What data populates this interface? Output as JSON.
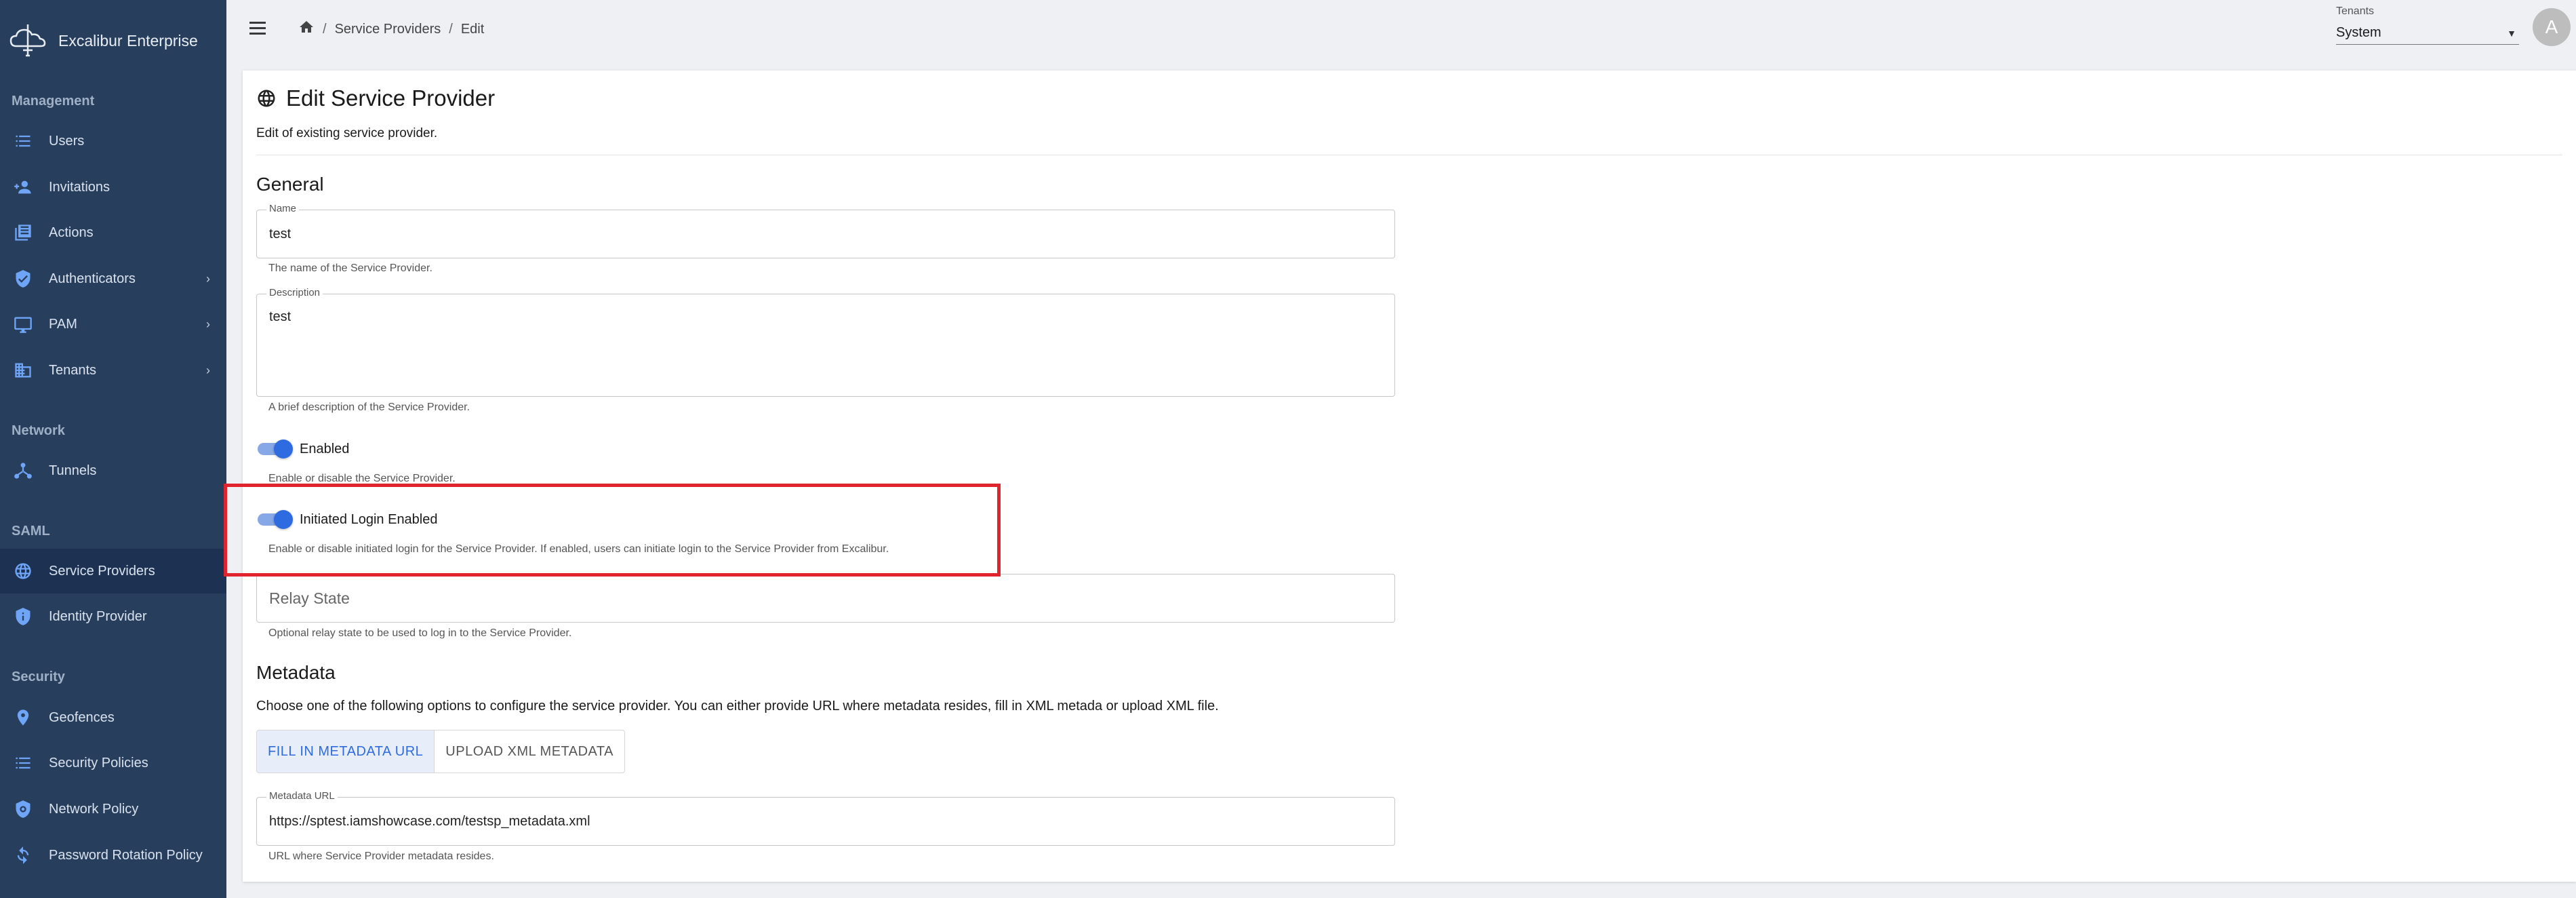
{
  "app": {
    "name": "Excalibur Enterprise"
  },
  "sidebar": {
    "sections": [
      {
        "title": "Management"
      },
      {
        "title": "Network"
      },
      {
        "title": "SAML"
      },
      {
        "title": "Security"
      }
    ],
    "items": [
      {
        "label": "Users",
        "icon": "list-icon"
      },
      {
        "label": "Invitations",
        "icon": "person-add-icon"
      },
      {
        "label": "Actions",
        "icon": "actions-icon"
      },
      {
        "label": "Authenticators",
        "icon": "shield-check-icon",
        "chevron": "›"
      },
      {
        "label": "PAM",
        "icon": "monitor-icon",
        "chevron": "›"
      },
      {
        "label": "Tenants",
        "icon": "building-icon",
        "chevron": "›"
      },
      {
        "label": "Tunnels",
        "icon": "network-icon"
      },
      {
        "label": "Service Providers",
        "icon": "globe-icon",
        "active": true
      },
      {
        "label": "Identity Provider",
        "icon": "shield-info-icon"
      },
      {
        "label": "Geofences",
        "icon": "location-pin-icon"
      },
      {
        "label": "Security Policies",
        "icon": "list-icon"
      },
      {
        "label": "Network Policy",
        "icon": "shield-gear-icon"
      },
      {
        "label": "Password Rotation Policy",
        "icon": "rotation-icon"
      }
    ]
  },
  "topbar": {
    "breadcrumb": [
      "Service Providers",
      "Edit"
    ],
    "breadcrumb_sep": "/",
    "tenants_label": "Tenants",
    "tenants_value": "System",
    "avatar_letter": "A"
  },
  "page": {
    "title": "Edit Service Provider",
    "subtitle": "Edit of existing service provider.",
    "general_heading": "General",
    "name": {
      "label": "Name",
      "value": "test",
      "helper": "The name of the Service Provider."
    },
    "description": {
      "label": "Description",
      "value": "test",
      "helper": "A brief description of the Service Provider."
    },
    "enabled": {
      "label": "Enabled",
      "on": true,
      "helper": "Enable or disable the Service Provider."
    },
    "initiated_login": {
      "label": "Initiated Login Enabled",
      "on": true,
      "helper": "Enable or disable initiated login for the Service Provider. If enabled, users can initiate login to the Service Provider from Excalibur."
    },
    "relay_state": {
      "placeholder": "Relay State",
      "helper": "Optional relay state to be used to log in to the Service Provider."
    },
    "metadata_heading": "Metadata",
    "metadata_desc": "Choose one of the following options to configure the service provider. You can either provide URL where metadata resides, fill in XML metada or upload XML file.",
    "metadata_options": [
      "FILL IN METADATA URL",
      "UPLOAD XML METADATA"
    ],
    "metadata_url": {
      "label": "Metadata URL",
      "value": "https://sptest.iamshowcase.com/testsp_metadata.xml",
      "helper": "URL where Service Provider metadata resides."
    }
  },
  "colors": {
    "sidebar_bg": "#283e5d",
    "accent": "#2f6be0",
    "highlight": "#e0232c"
  }
}
